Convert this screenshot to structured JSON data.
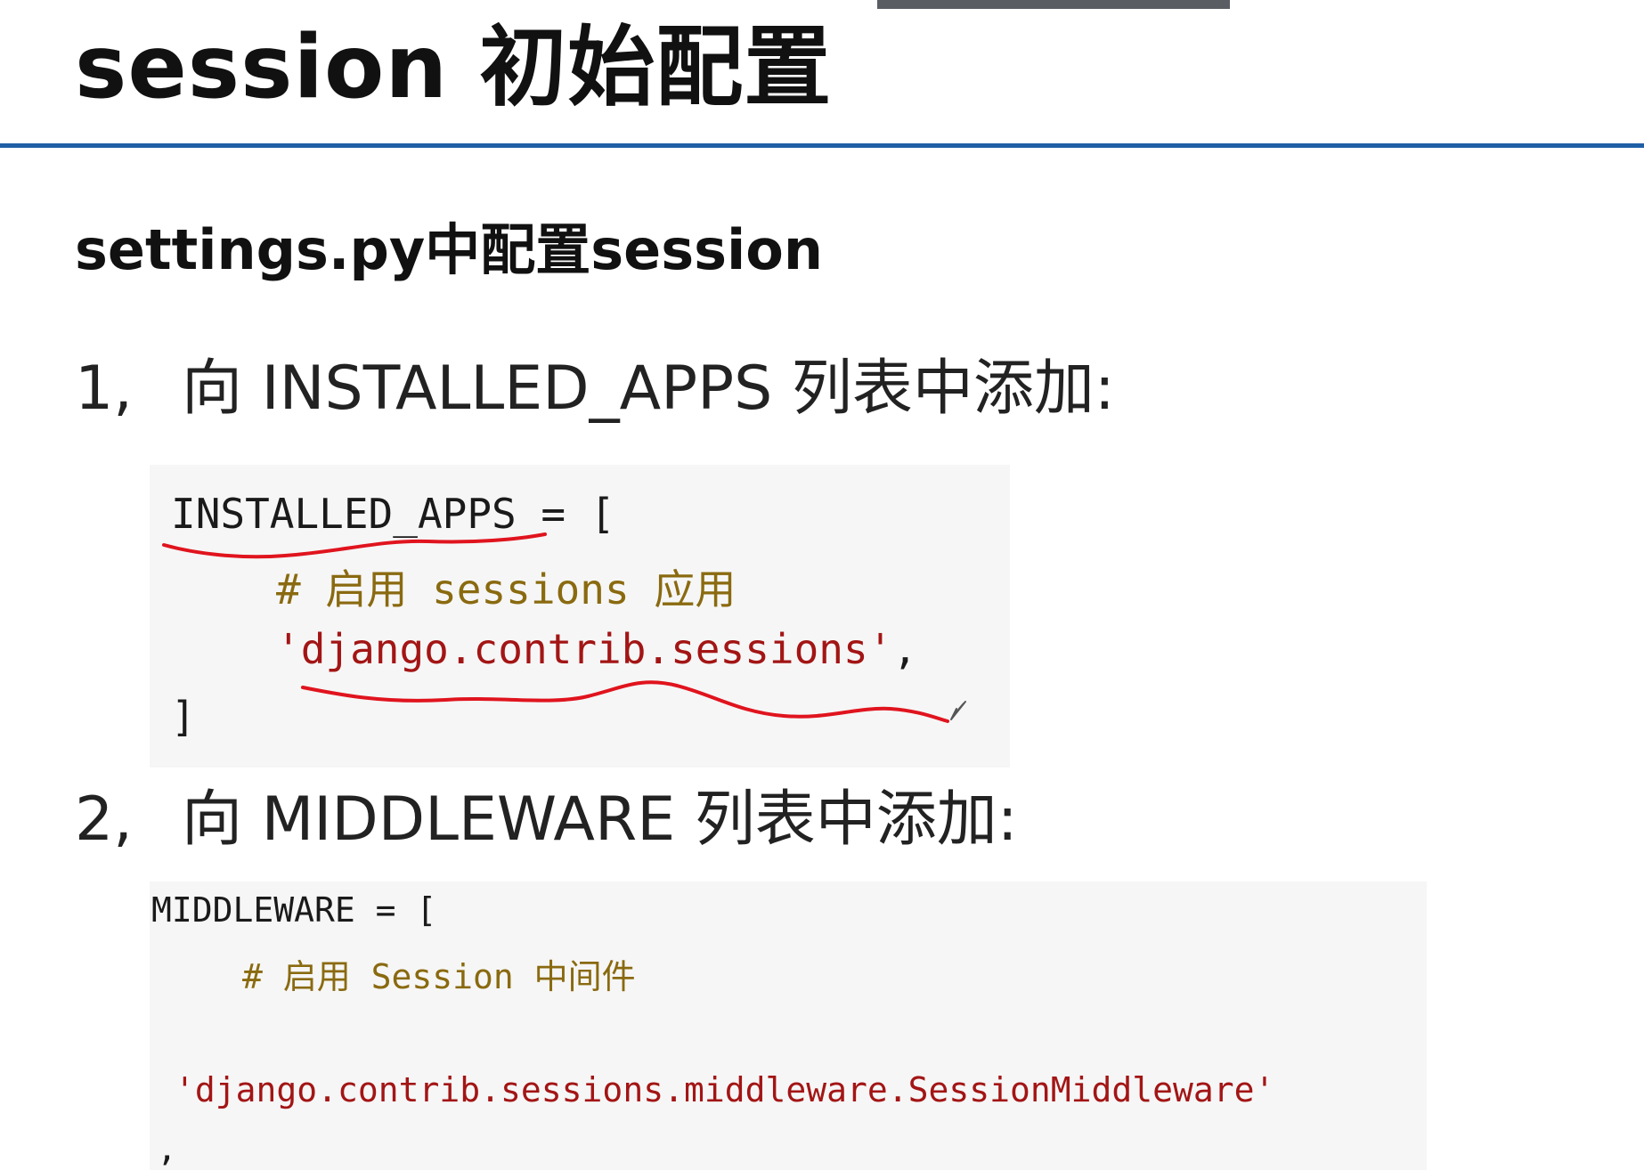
{
  "slide": {
    "title": "session 初始配置",
    "subtitle": "settings.py中配置session"
  },
  "step1": {
    "number": "1,",
    "heading": "向 INSTALLED_APPS 列表中添加:",
    "code": {
      "line1": "INSTALLED_APPS = [",
      "comment": "# 启用 sessions 应用",
      "string": "'django.contrib.sessions'",
      "comma": ",",
      "close": "]"
    }
  },
  "step2": {
    "number": "2,",
    "heading": "向 MIDDLEWARE 列表中添加:",
    "code": {
      "line1": "MIDDLEWARE = [",
      "comment": "# 启用 Session 中间件",
      "string": "'django.contrib.sessions.middleware.SessionMiddleware'",
      "comma": ","
    }
  },
  "colors": {
    "title_rule": "#1f5fa5",
    "code_bg": "#f6f6f6",
    "comment": "#8a6a10",
    "string": "#a31515",
    "annotation_ink": "#e0141e"
  }
}
